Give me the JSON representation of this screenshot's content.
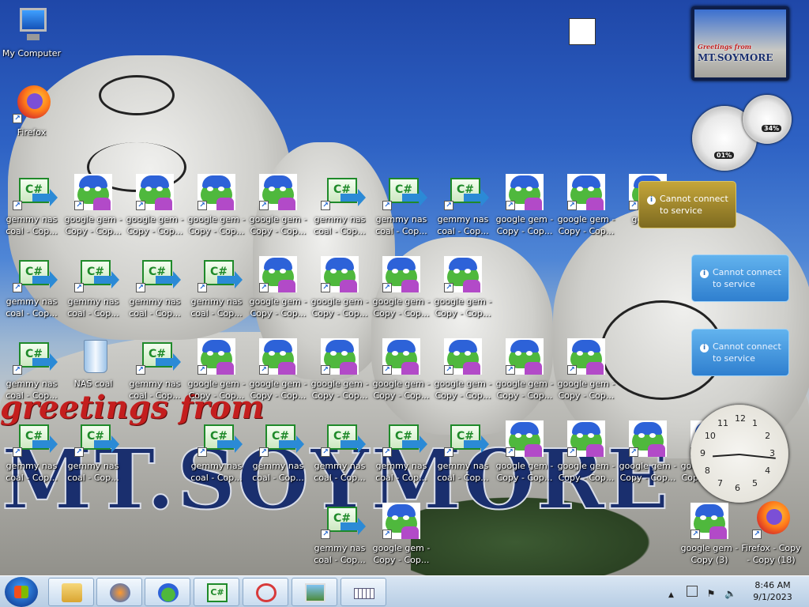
{
  "wallpaper": {
    "greeting": "greetings from",
    "place": "MT.SOYMORE"
  },
  "icons": [
    {
      "label": "My Computer",
      "type": "pc"
    },
    {
      "label": "Firefox",
      "type": "firefox"
    },
    {
      "label": "",
      "type": "soyjak"
    },
    {
      "label": "gemmy nas coal - Cop...",
      "type": "cs"
    },
    {
      "label": "google gem - Copy - Cop...",
      "type": "pepe"
    },
    {
      "label": "google gem - Copy - Cop...",
      "type": "pepe"
    },
    {
      "label": "google gem - Copy - Cop...",
      "type": "pepe"
    },
    {
      "label": "google gem - Copy - Cop...",
      "type": "pepe"
    },
    {
      "label": "gemmy nas coal - Cop...",
      "type": "cs"
    },
    {
      "label": "gemmy nas coal - Cop...",
      "type": "cs"
    },
    {
      "label": "gemmy nas coal - Cop...",
      "type": "cs"
    },
    {
      "label": "google gem - Copy - Cop...",
      "type": "pepe"
    },
    {
      "label": "google gem - Copy - Cop...",
      "type": "pepe"
    },
    {
      "label": "googl...",
      "type": "pepe"
    },
    {
      "label": "gemmy nas coal - Cop...",
      "type": "cs"
    },
    {
      "label": "gemmy nas coal - Cop...",
      "type": "cs"
    },
    {
      "label": "gemmy nas coal - Cop...",
      "type": "cs"
    },
    {
      "label": "gemmy nas coal - Cop...",
      "type": "cs"
    },
    {
      "label": "google gem - Copy - Cop...",
      "type": "pepe"
    },
    {
      "label": "google gem - Copy - Cop...",
      "type": "pepe"
    },
    {
      "label": "google gem - Copy - Cop...",
      "type": "pepe"
    },
    {
      "label": "google gem - Copy - Cop...",
      "type": "pepe"
    },
    {
      "label": "gemmy nas coal - Cop...",
      "type": "cs"
    },
    {
      "label": "NAS coal",
      "type": "bin"
    },
    {
      "label": "gemmy nas coal - Cop...",
      "type": "cs"
    },
    {
      "label": "google gem - Copy - Cop...",
      "type": "pepe"
    },
    {
      "label": "google gem - Copy - Cop...",
      "type": "pepe"
    },
    {
      "label": "google gem - Copy - Cop...",
      "type": "pepe"
    },
    {
      "label": "google gem - Copy - Cop...",
      "type": "pepe"
    },
    {
      "label": "google gem - Copy - Cop...",
      "type": "pepe"
    },
    {
      "label": "google gem - Copy - Cop...",
      "type": "pepe"
    },
    {
      "label": "google gem - Copy - Cop...",
      "type": "pepe"
    },
    {
      "label": "gemmy nas coal - Cop...",
      "type": "cs"
    },
    {
      "label": "gemmy nas coal - Cop...",
      "type": "cs"
    },
    {
      "label": "gemmy nas coal - Cop...",
      "type": "cs"
    },
    {
      "label": "gemmy nas coal - Cop...",
      "type": "cs"
    },
    {
      "label": "gemmy nas coal - Cop...",
      "type": "cs"
    },
    {
      "label": "gemmy nas coal - Cop...",
      "type": "cs"
    },
    {
      "label": "gemmy nas coal - Cop...",
      "type": "cs"
    },
    {
      "label": "google gem - Copy - Cop...",
      "type": "pepe"
    },
    {
      "label": "google gem - Copy - Cop...",
      "type": "pepe"
    },
    {
      "label": "google gem - Copy - Cop...",
      "type": "pepe"
    },
    {
      "label": "google gem - Copy - Cop...",
      "type": "pepe"
    },
    {
      "label": "gemmy nas coal - Cop...",
      "type": "cs"
    },
    {
      "label": "google gem - Copy - Cop...",
      "type": "pepe"
    },
    {
      "label": "google gem - Copy (3)",
      "type": "pepe"
    },
    {
      "label": "Firefox - Copy - Copy (18)",
      "type": "firefox"
    },
    {
      "label": "g",
      "type": "pepe"
    }
  ],
  "gadgets": {
    "slideshow_greeting": "Greetings from",
    "slideshow_title": "MT.SOYMORE",
    "cpu_percent": "01%",
    "memory_percent": "34%",
    "notice_1": "Cannot connect to service",
    "notice_2": "Cannot connect to service",
    "notice_3": "Cannot connect to service",
    "clock_numbers": [
      "10",
      "11",
      "12",
      "1",
      "2",
      "3",
      "4",
      "5",
      "6",
      "7",
      "8",
      "9"
    ]
  },
  "taskbar": {
    "time": "8:46 AM",
    "date": "9/1/2023",
    "tray_expand": "▲",
    "buttons": [
      "file-explorer",
      "media-player",
      "google-gem",
      "csharp-app",
      "snipping-tool",
      "picture-viewer",
      "keyboard"
    ]
  }
}
